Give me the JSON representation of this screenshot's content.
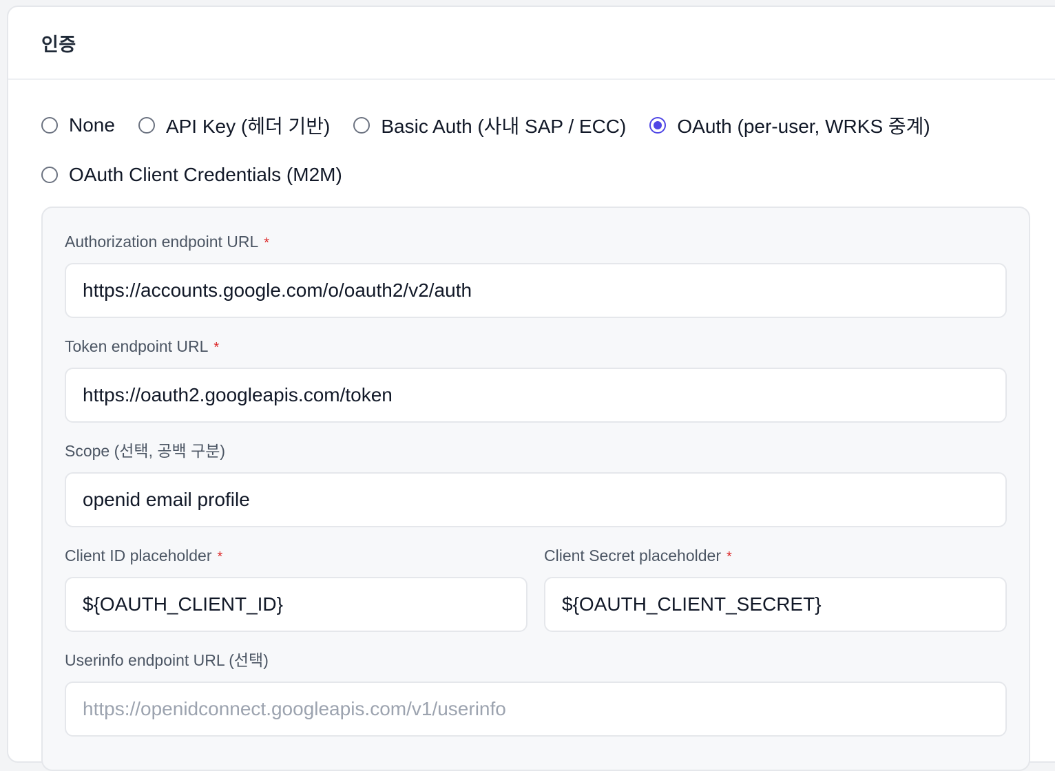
{
  "card": {
    "title": "인증"
  },
  "auth_options": [
    {
      "label": "None",
      "checked": false
    },
    {
      "label": "API Key (헤더 기반)",
      "checked": false
    },
    {
      "label": "Basic Auth (사내 SAP / ECC)",
      "checked": false
    },
    {
      "label": "OAuth (per-user, WRKS 중계)",
      "checked": true
    },
    {
      "label": "OAuth Client Credentials (M2M)",
      "checked": false
    }
  ],
  "fields": {
    "auth_url": {
      "label": "Authorization endpoint URL",
      "required_mark": "*",
      "value": "https://accounts.google.com/o/oauth2/v2/auth"
    },
    "token_url": {
      "label": "Token endpoint URL",
      "required_mark": "*",
      "value": "https://oauth2.googleapis.com/token"
    },
    "scope": {
      "label": "Scope (선택, 공백 구분)",
      "value": "openid email profile"
    },
    "client_id": {
      "label": "Client ID placeholder",
      "required_mark": "*",
      "value": "${OAUTH_CLIENT_ID}"
    },
    "client_secret": {
      "label": "Client Secret placeholder",
      "required_mark": "*",
      "value": "${OAUTH_CLIENT_SECRET}"
    },
    "userinfo_url": {
      "label": "Userinfo endpoint URL (선택)",
      "value": "",
      "placeholder": "https://openidconnect.googleapis.com/v1/userinfo"
    }
  },
  "colors": {
    "accent": "#4f46e5",
    "required": "#dc2626"
  }
}
